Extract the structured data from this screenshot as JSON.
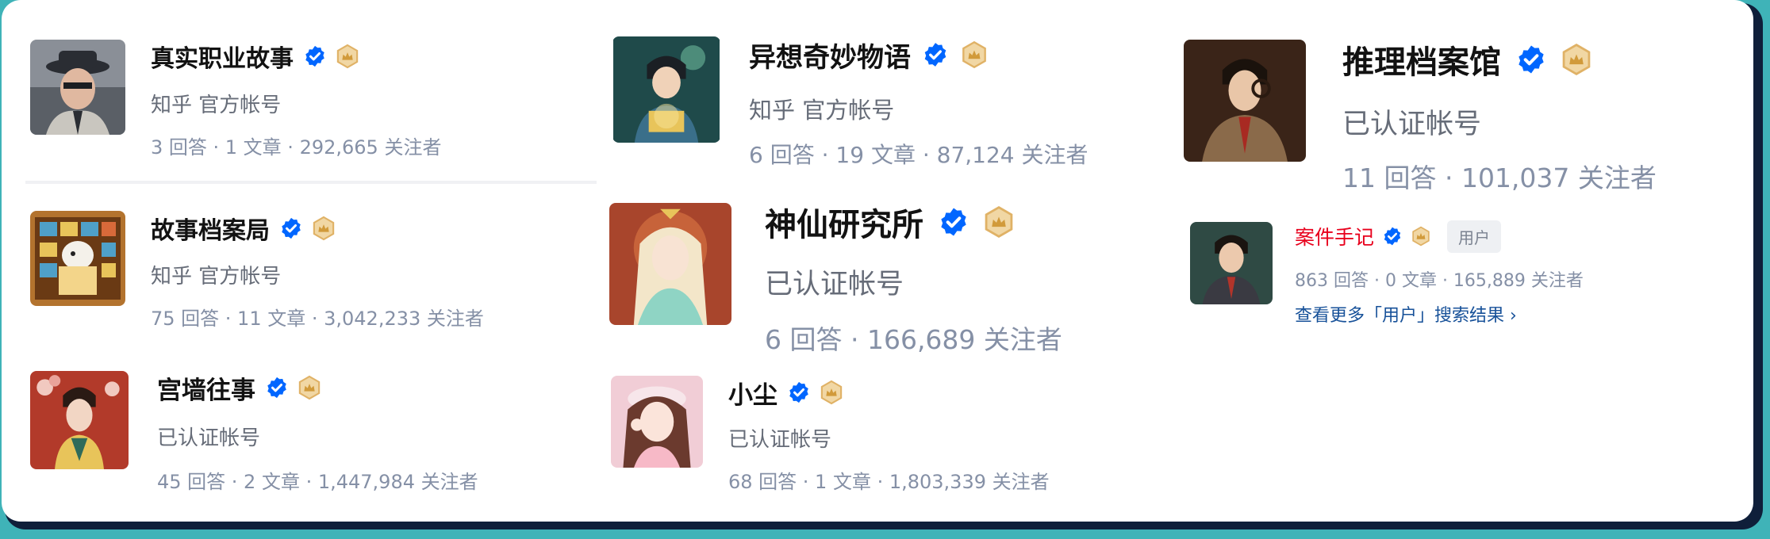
{
  "colors": {
    "verified_blue": "#0066ff",
    "gold_badge": "#e0b266",
    "highlight_red": "#e8001c",
    "link_blue": "#175199",
    "card_border": "#0f1f3a",
    "page_bg": "#3fb3b8"
  },
  "icons": {
    "verified": "verified-badge-icon",
    "gold": "crown-medal-icon",
    "more_arrow": "chevron-right-icon"
  },
  "results": [
    {
      "name": "真实职业故事",
      "sub": "知乎 官方帐号",
      "stats": "3 回答 · 1 文章 · 292,665 关注者"
    },
    {
      "name": "故事档案局",
      "sub": "知乎 官方帐号",
      "stats": "75 回答 · 11 文章 · 3,042,233 关注者"
    },
    {
      "name": "宫墙往事",
      "sub": "已认证帐号",
      "stats": "45 回答 · 2 文章 · 1,447,984 关注者"
    },
    {
      "name": "异想奇妙物语",
      "sub": "知乎 官方帐号",
      "stats": "6 回答 · 19 文章 · 87,124 关注者"
    },
    {
      "name": "神仙研究所",
      "sub": "已认证帐号",
      "stats": "6 回答 · 166,689 关注者"
    },
    {
      "name": "小尘",
      "sub": "已认证帐号",
      "stats": "68 回答 · 1 文章 · 1,803,339 关注者"
    },
    {
      "name": "推理档案馆",
      "sub": "已认证帐号",
      "stats": "11 回答 · 101,037 关注者"
    },
    {
      "name": "案件手记",
      "tag": "用户",
      "stats": "863 回答 · 0 文章 · 165,889 关注者"
    }
  ],
  "more_link": "查看更多「用户」搜索结果 ›"
}
